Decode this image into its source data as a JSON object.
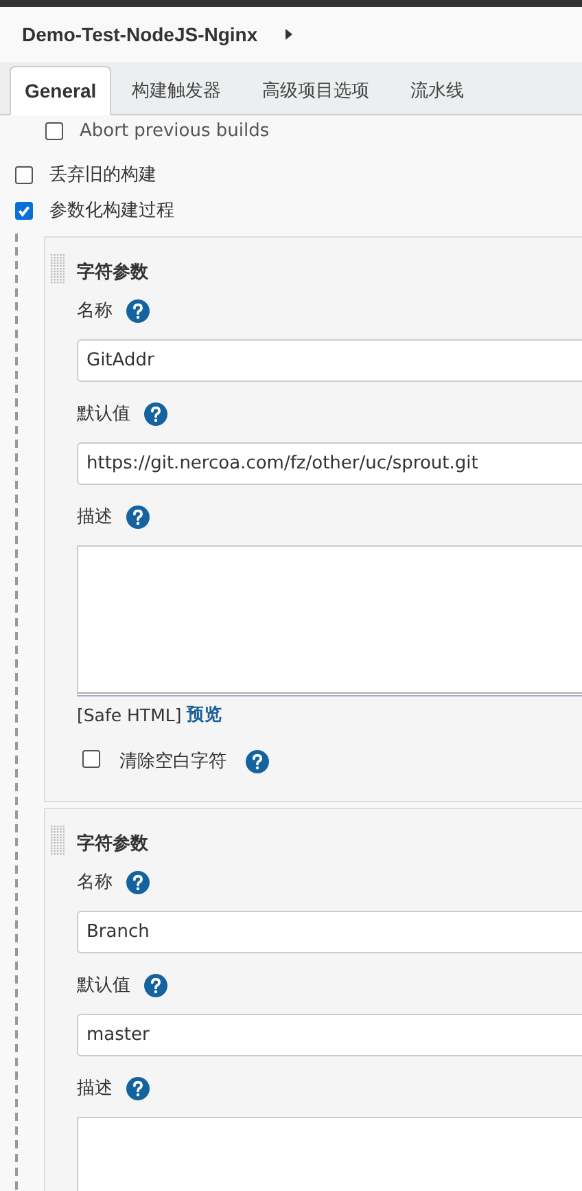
{
  "header": {
    "title": "Demo-Test-NodeJS-Nginx"
  },
  "tabs": [
    {
      "label": "General",
      "selected": true
    },
    {
      "label": "构建触发器",
      "selected": false
    },
    {
      "label": "高级项目选项",
      "selected": false
    },
    {
      "label": "流水线",
      "selected": false
    }
  ],
  "abort_option": {
    "label": "Abort previous builds",
    "checked": false
  },
  "options": [
    {
      "label": "丢弃旧的构建",
      "checked": false
    },
    {
      "label": "参数化构建过程",
      "checked": true
    }
  ],
  "parameters": [
    {
      "title": "字符参数",
      "fields": [
        {
          "kind": "input",
          "label": "名称",
          "value": "GitAddr"
        },
        {
          "kind": "input",
          "label": "默认值",
          "value": "https://git.nercoa.com/fz/other/uc/sprout.git"
        },
        {
          "kind": "textarea",
          "label": "描述"
        }
      ],
      "safe_html": "[Safe HTML]",
      "preview": "预览",
      "trim": {
        "label": "清除空白字符",
        "checked": false
      }
    },
    {
      "title": "字符参数",
      "fields": [
        {
          "kind": "input",
          "label": "名称",
          "value": "Branch"
        },
        {
          "kind": "input",
          "label": "默认值",
          "value": "master"
        },
        {
          "kind": "textarea",
          "label": "描述"
        }
      ]
    }
  ]
}
